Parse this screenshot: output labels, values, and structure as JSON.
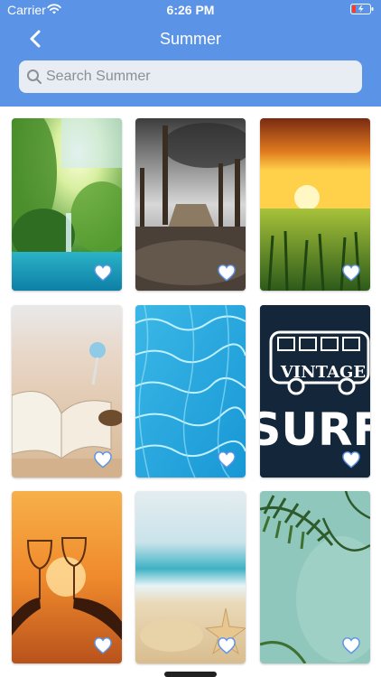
{
  "status_bar": {
    "carrier": "Carrier",
    "time": "6:26 PM"
  },
  "nav": {
    "title": "Summer",
    "back_icon": "chevron-left-icon"
  },
  "search": {
    "placeholder": "Search Summer",
    "value": ""
  },
  "colors": {
    "header": "#5b93e6",
    "heart": "#ffffff",
    "heart_outline": "#5b93e6"
  },
  "wallpapers": [
    {
      "name": "waterfall-forest",
      "favorite_icon": "heart-icon"
    },
    {
      "name": "wooden-pier-storm",
      "favorite_icon": "heart-icon"
    },
    {
      "name": "sunset-cornfield",
      "favorite_icon": "heart-icon"
    },
    {
      "name": "book-on-beach",
      "favorite_icon": "heart-icon"
    },
    {
      "name": "pool-water",
      "favorite_icon": "heart-icon"
    },
    {
      "name": "vintage-surf-van",
      "favorite_icon": "heart-icon"
    },
    {
      "name": "sunset-wine-toast",
      "favorite_icon": "heart-icon"
    },
    {
      "name": "beach-starfish",
      "favorite_icon": "heart-icon"
    },
    {
      "name": "palm-leaves",
      "favorite_icon": "heart-icon"
    }
  ],
  "tile_text": {
    "vintage": "VINTAGE",
    "surf": "SURF"
  }
}
